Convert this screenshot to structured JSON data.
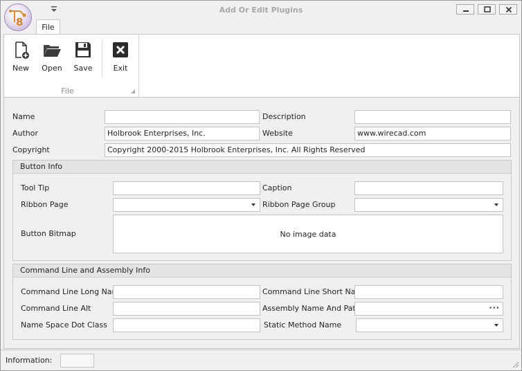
{
  "window": {
    "title": "Add Or Edit Plugins",
    "minimize_icon": "minimize-icon",
    "maximize_icon": "maximize-icon",
    "close_icon": "close-icon",
    "app_logo_icon": "app-logo-icon",
    "qat_icon": "quick-access-dropdown-icon"
  },
  "ribbon": {
    "tab_label": "File",
    "group_label": "File",
    "buttons": [
      {
        "label": "New",
        "icon": "new-document-icon"
      },
      {
        "label": "Open",
        "icon": "open-folder-icon"
      },
      {
        "label": "Save",
        "icon": "save-floppy-icon"
      },
      {
        "label": "Exit",
        "icon": "exit-x-icon"
      }
    ]
  },
  "form": {
    "name_label": "Name",
    "name_value": "",
    "description_label": "Description",
    "description_value": "",
    "author_label": "Author",
    "author_value": "Holbrook Enterprises, Inc.",
    "website_label": "Website",
    "website_value": "www.wirecad.com",
    "copyright_label": "Copyright",
    "copyright_value": "Copyright 2000-2015 Holbrook Enterprises, Inc. All Rights Reserved"
  },
  "button_info": {
    "header": "Button Info",
    "tooltip_label": "Tool Tip",
    "tooltip_value": "",
    "caption_label": "Caption",
    "caption_value": "",
    "ribbon_page_label": "Ribbon Page",
    "ribbon_page_value": "",
    "ribbon_page_group_label": "Ribbon Page Group",
    "ribbon_page_group_value": "",
    "bitmap_label": "Button Bitmap",
    "bitmap_empty_text": "No image data"
  },
  "command_info": {
    "header": "Command Line and Assembly Info",
    "long_name_label": "Command Line Long Name",
    "long_name_value": "",
    "short_name_label": "Command Line Short Name",
    "short_name_value": "",
    "alt_label": "Command Line Alt",
    "alt_value": "",
    "assembly_label": "Assembly Name And Path",
    "assembly_value": "",
    "assembly_browse_label": "···",
    "namespace_label": "Name Space Dot Class",
    "namespace_value": "",
    "static_method_label": "Static Method Name",
    "static_method_value": ""
  },
  "status": {
    "information_label": "Information:",
    "information_value": ""
  }
}
